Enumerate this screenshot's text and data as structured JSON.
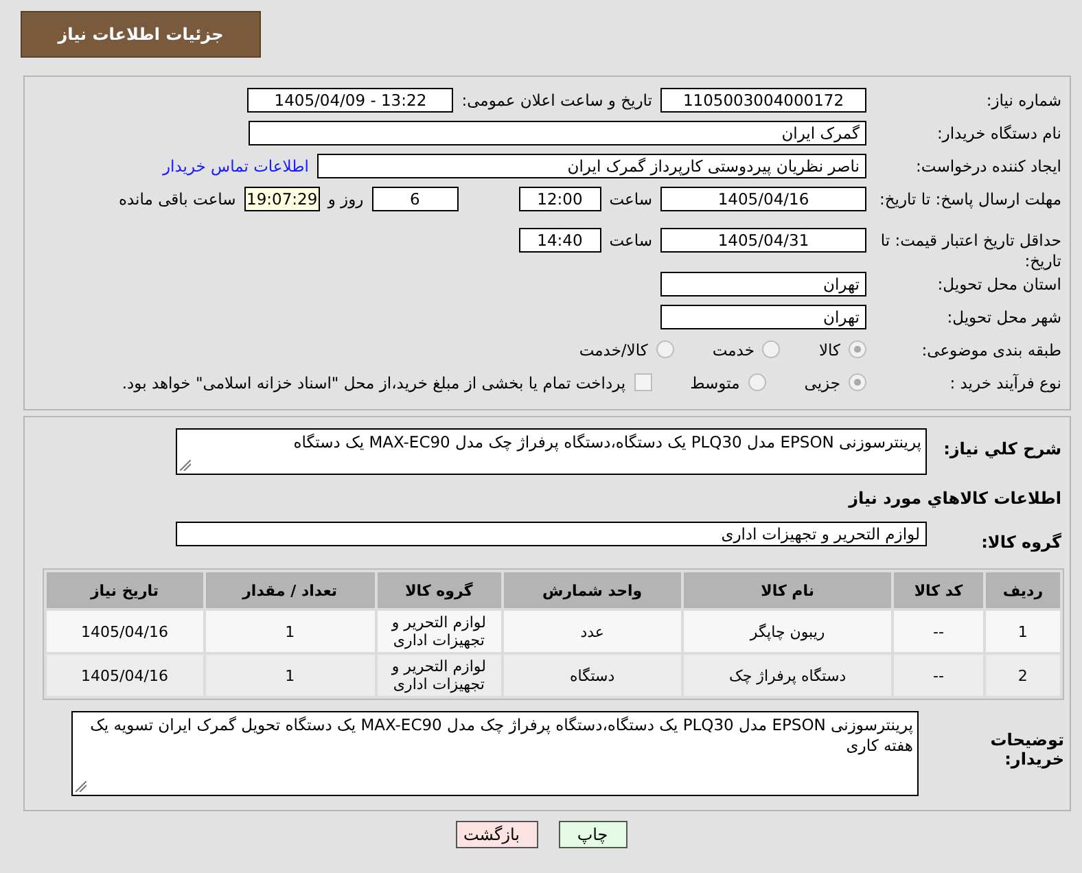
{
  "header": {
    "title": "جزئیات اطلاعات نیاز"
  },
  "need_number": {
    "label": "شماره نیاز:",
    "value": "1105003004000172"
  },
  "announce": {
    "label": "تاریخ و ساعت اعلان عمومی:",
    "value": "1405/04/09 - 13:22"
  },
  "buyer_org": {
    "label": "نام دستگاه خریدار:",
    "value": "گمرک ایران"
  },
  "requester": {
    "label": "ایجاد کننده درخواست:",
    "value": "ناصر نظریان پیردوستی کارپرداز گمرک ایران",
    "contact_link": "اطلاعات تماس خریدار"
  },
  "reply_deadline": {
    "label": "مهلت ارسال پاسخ: تا تاریخ:",
    "date": "1405/04/16",
    "time_label": "ساعت",
    "time": "12:00",
    "days": "6",
    "days_label": "روز و",
    "remaining": "19:07:29",
    "remaining_label": "ساعت باقی مانده"
  },
  "price_validity": {
    "label": "حداقل تاریخ اعتبار قیمت: تا تاریخ:",
    "date": "1405/04/31",
    "time_label": "ساعت",
    "time": "14:40"
  },
  "province": {
    "label": "استان محل تحویل:",
    "value": "تهران"
  },
  "city": {
    "label": "شهر محل تحویل:",
    "value": "تهران"
  },
  "category": {
    "label": "طبقه بندی موضوعی:",
    "options": [
      {
        "label": "کالا",
        "selected": true
      },
      {
        "label": "خدمت",
        "selected": false
      },
      {
        "label": "کالا/خدمت",
        "selected": false
      }
    ]
  },
  "purchase_type": {
    "label": "نوع فرآیند خرید :",
    "options": [
      {
        "label": "جزیی",
        "selected": true
      },
      {
        "label": "متوسط",
        "selected": false
      }
    ],
    "payment_option": {
      "checked": false,
      "text": "پرداخت تمام یا بخشی از مبلغ خرید،از محل \"اسناد خزانه اسلامی\" خواهد بود."
    }
  },
  "description": {
    "label": "شرح كلي نياز:",
    "value": "پرینترسوزنی EPSON مدل PLQ30  یک دستگاه،دستگاه پرفراژ چک مدل MAX-EC90  یک دستگاه"
  },
  "goods_heading": "اطلاعات كالاهاي مورد نياز",
  "goods_group": {
    "label": "گروه کالا:",
    "value": "لوازم التحریر و تجهیزات اداری"
  },
  "table": {
    "columns": [
      "ردیف",
      "کد کالا",
      "نام کالا",
      "واحد شمارش",
      "گروه کالا",
      "تعداد / مقدار",
      "تاریخ نیاز"
    ],
    "rows": [
      [
        "1",
        "--",
        "ریبون چاپگر",
        "عدد",
        "لوازم التحریر و تجهیزات اداری",
        "1",
        "1405/04/16"
      ],
      [
        "2",
        "--",
        "دستگاه پرفراژ چک",
        "دستگاه",
        "لوازم التحریر و تجهیزات اداری",
        "1",
        "1405/04/16"
      ]
    ]
  },
  "buyer_notes": {
    "label": "توضیحات خریدار:",
    "value": "پرینترسوزنی EPSON مدل PLQ30  یک دستگاه،دستگاه پرفراژ چک مدل MAX-EC90  یک دستگاه تحویل گمرک ایران تسویه یک هفته کاری"
  },
  "buttons": [
    {
      "label": "چاپ",
      "kind": "print"
    },
    {
      "label": "بازگشت",
      "kind": "back"
    }
  ]
}
